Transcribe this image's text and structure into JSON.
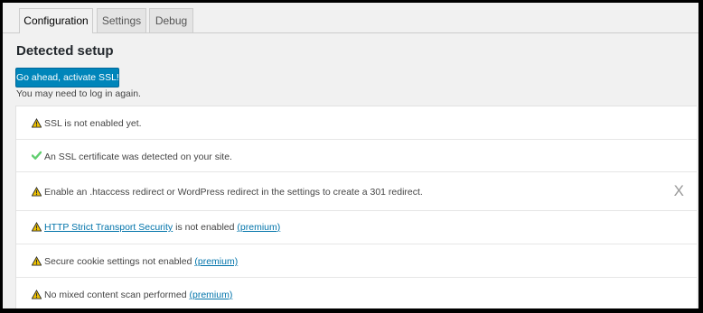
{
  "tabs": [
    {
      "label": "Configuration",
      "active": true
    },
    {
      "label": "Settings",
      "active": false
    },
    {
      "label": "Debug",
      "active": false
    }
  ],
  "section_title": "Detected setup",
  "activate_button": "Go ahead, activate SSL!",
  "login_note": "You may need to log in again.",
  "notices": {
    "ssl_not_enabled": {
      "status": "warning",
      "text": "SSL is not enabled yet."
    },
    "cert_detected": {
      "status": "ok",
      "text": "An SSL certificate was detected on your site."
    },
    "redirect": {
      "status": "warning",
      "text": "Enable an .htaccess redirect or WordPress redirect in the settings to create a 301 redirect.",
      "dismiss": "X"
    },
    "hsts": {
      "status": "warning",
      "link": "HTTP Strict Transport Security",
      "text": " is not enabled ",
      "premium": "(premium)"
    },
    "cookies": {
      "status": "warning",
      "text": "Secure cookie settings not enabled ",
      "premium": "(premium)"
    },
    "mixed": {
      "status": "warning",
      "text": "No mixed content scan performed ",
      "premium": "(premium)"
    }
  },
  "colors": {
    "warning": "#f0c300",
    "ok": "#61ce70",
    "link": "#0073aa",
    "button": "#0085ba"
  },
  "icons": {
    "warning": "warning-icon",
    "ok": "check-icon"
  }
}
